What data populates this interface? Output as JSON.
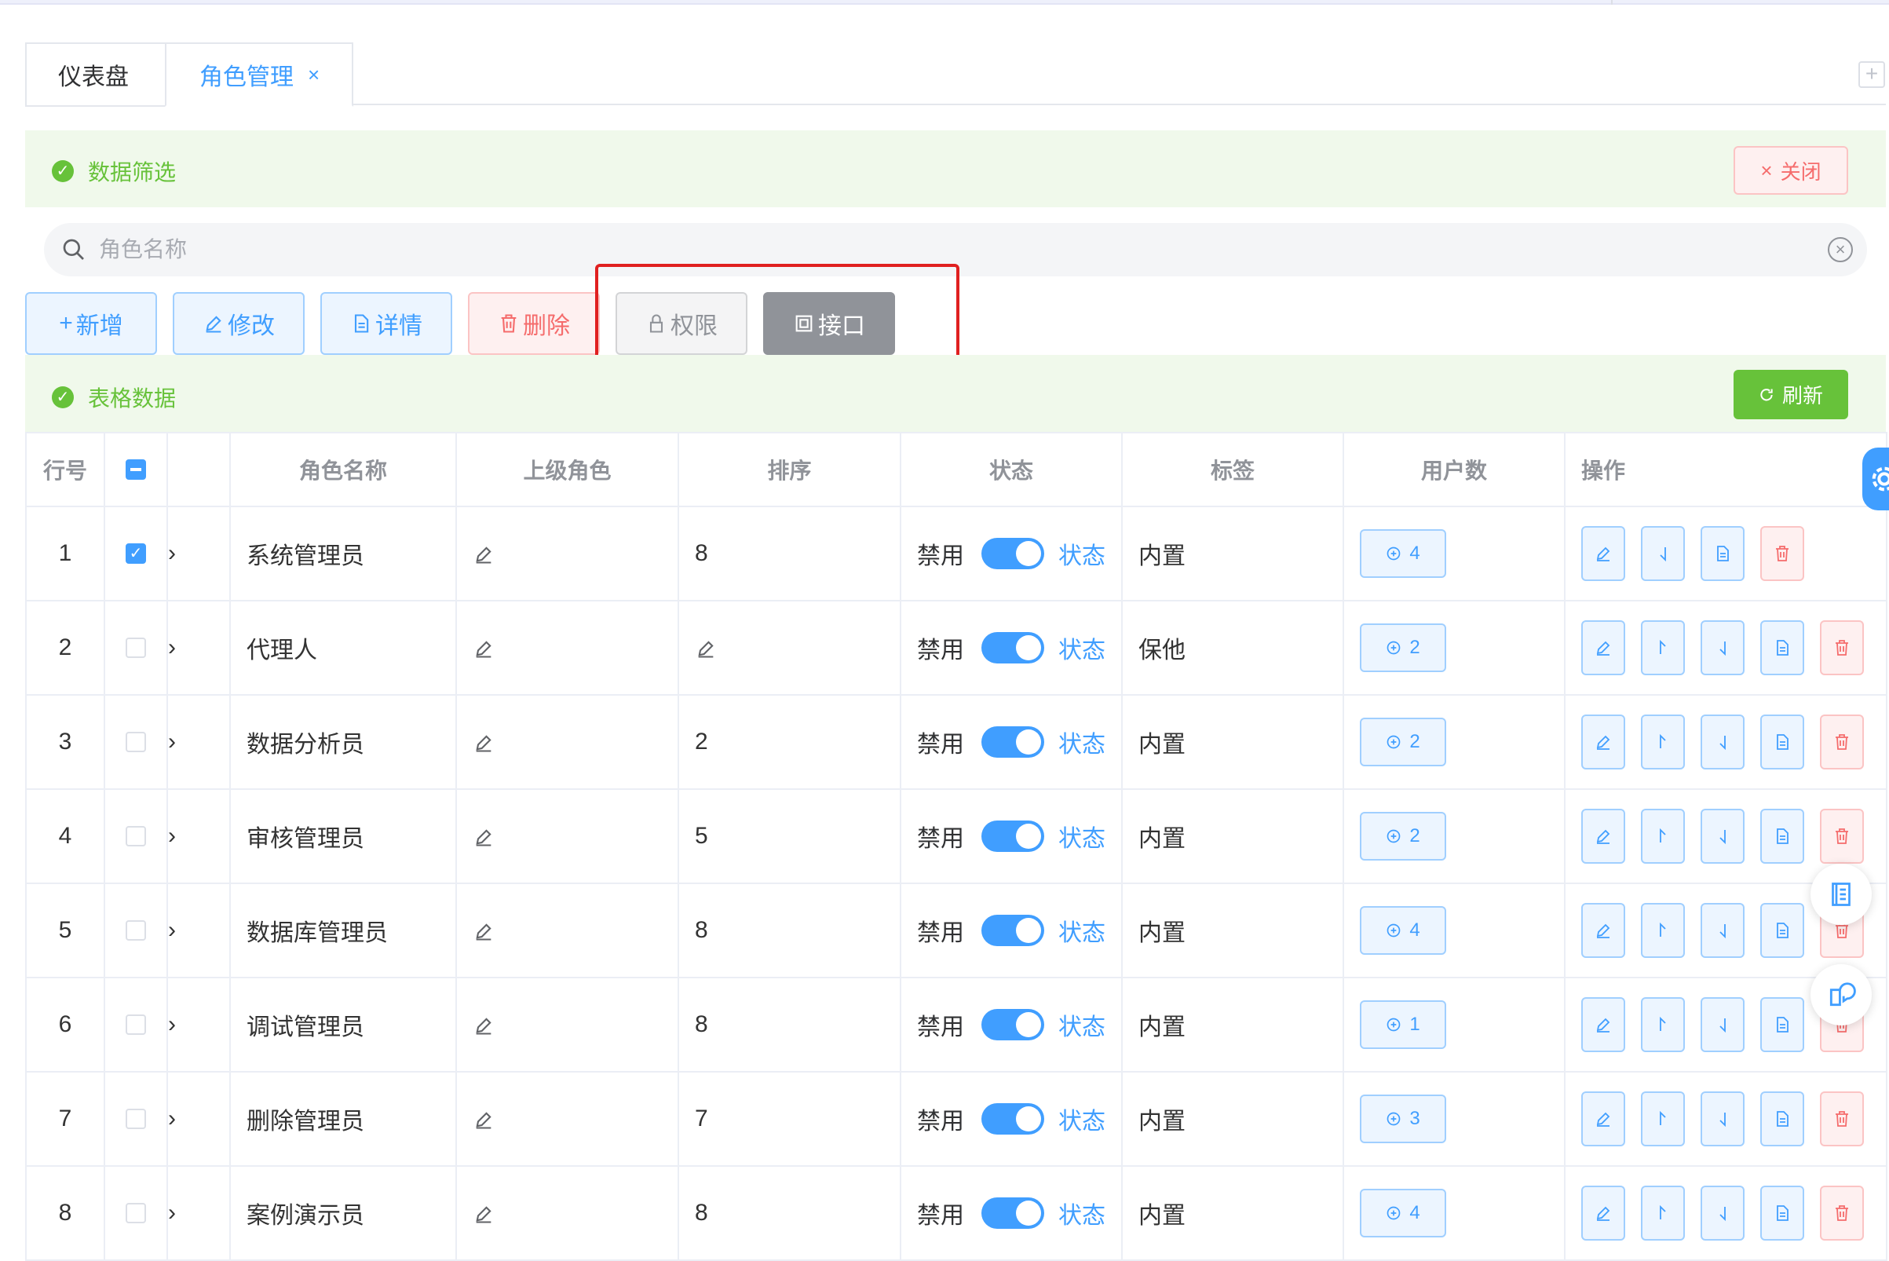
{
  "tabs": [
    {
      "label": "仪表盘"
    },
    {
      "label": "角色管理",
      "close": "×"
    }
  ],
  "filter_panel": {
    "title": "数据筛选",
    "close_label": "关闭"
  },
  "search": {
    "placeholder": "角色名称",
    "value": ""
  },
  "toolbar": {
    "add": "新增",
    "edit": "修改",
    "detail": "详情",
    "delete": "删除",
    "permission": "权限",
    "api": "接口"
  },
  "table_panel": {
    "title": "表格数据",
    "refresh_label": "刷新"
  },
  "table": {
    "headers": [
      "行号",
      "",
      "",
      "角色名称",
      "上级角色",
      "排序",
      "状态",
      "标签",
      "用户数",
      "操作"
    ],
    "status_off": "禁用",
    "status_on": "状态",
    "rows": [
      {
        "idx": "1",
        "name": "系统管理员",
        "sort": "8",
        "tag": "内置",
        "users": "4",
        "checked": true,
        "sort_icon": false,
        "ops": [
          "edit",
          "down",
          "doc",
          "del"
        ]
      },
      {
        "idx": "2",
        "name": "代理人",
        "sort": "",
        "tag": "保他",
        "users": "2",
        "checked": false,
        "sort_icon": true,
        "ops": [
          "edit",
          "up",
          "down",
          "doc",
          "del"
        ]
      },
      {
        "idx": "3",
        "name": "数据分析员",
        "sort": "2",
        "tag": "内置",
        "users": "2",
        "checked": false,
        "sort_icon": false,
        "ops": [
          "edit",
          "up",
          "down",
          "doc",
          "del"
        ]
      },
      {
        "idx": "4",
        "name": "审核管理员",
        "sort": "5",
        "tag": "内置",
        "users": "2",
        "checked": false,
        "sort_icon": false,
        "ops": [
          "edit",
          "up",
          "down",
          "doc",
          "del"
        ]
      },
      {
        "idx": "5",
        "name": "数据库管理员",
        "sort": "8",
        "tag": "内置",
        "users": "4",
        "checked": false,
        "sort_icon": false,
        "ops": [
          "edit",
          "up",
          "down",
          "doc",
          "del"
        ]
      },
      {
        "idx": "6",
        "name": "调试管理员",
        "sort": "8",
        "tag": "内置",
        "users": "1",
        "checked": false,
        "sort_icon": false,
        "ops": [
          "edit",
          "up",
          "down",
          "doc",
          "del"
        ]
      },
      {
        "idx": "7",
        "name": "删除管理员",
        "sort": "7",
        "tag": "内置",
        "users": "3",
        "checked": false,
        "sort_icon": false,
        "ops": [
          "edit",
          "up",
          "down",
          "doc",
          "del"
        ]
      },
      {
        "idx": "8",
        "name": "案例演示员",
        "sort": "8",
        "tag": "内置",
        "users": "4",
        "checked": false,
        "sort_icon": false,
        "ops": [
          "edit",
          "up",
          "down",
          "doc",
          "del"
        ]
      }
    ]
  },
  "icons": [
    "search-icon",
    "clear-icon",
    "close-icon",
    "plus-icon",
    "pen-icon",
    "document-icon",
    "trash-icon",
    "lock-icon",
    "api-icon",
    "refresh-icon",
    "check-circle-icon",
    "chevron-right-icon",
    "arrow-up-icon",
    "arrow-down-icon",
    "user-plus-icon",
    "book-icon",
    "chat-icon",
    "gear-icon"
  ],
  "colors": {
    "primary": "#409eff",
    "success": "#67c23a",
    "danger": "#f56c6c",
    "info": "#909399",
    "highlight": "#e02020"
  }
}
